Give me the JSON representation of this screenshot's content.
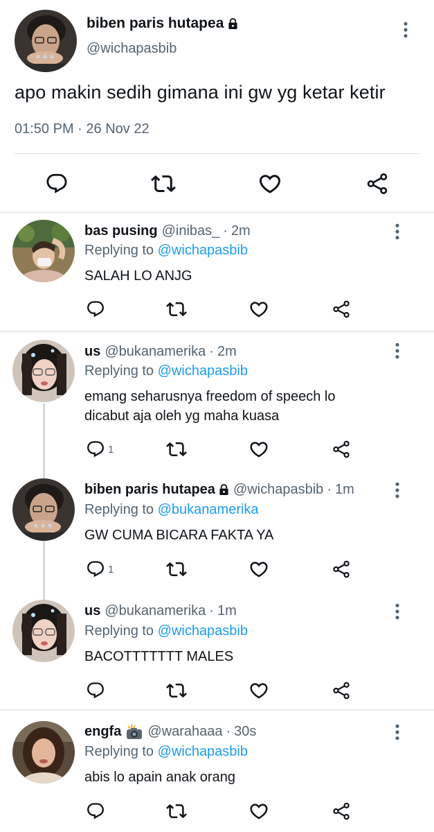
{
  "main_tweet": {
    "name": "biben paris hutapea",
    "handle": "@wichapasbib",
    "text": "apo makin sedih gimana ini gw yg ketar ketir",
    "time": "01:50 PM",
    "dot": "·",
    "date": "26 Nov 22",
    "protected_icon": "lock-icon"
  },
  "replies": [
    {
      "name": "bas pusing",
      "handle": "@inibas_",
      "time": "2m",
      "replying_label": "Replying to",
      "replying_to": "@wichapasbib",
      "text": "SALAH LO ANJG",
      "reply_count": ""
    },
    {
      "name": "us",
      "handle": "@bukanamerika",
      "time": "2m",
      "replying_label": "Replying to",
      "replying_to": "@wichapasbib",
      "text_line1": "emang seharusnya freedom of speech lo",
      "text_line2": "dicabut aja oleh yg maha kuasa",
      "reply_count": "1"
    },
    {
      "name": "biben paris hutapea",
      "handle": "@wichapasbib",
      "time": "1m",
      "replying_label": "Replying to",
      "replying_to": "@bukanamerika",
      "text": "GW CUMA BICARA FAKTA YA",
      "reply_count": "1"
    },
    {
      "name": "us",
      "handle": "@bukanamerika",
      "time": "1m",
      "replying_label": "Replying to",
      "replying_to": "@wichapasbib",
      "text": "BACOTTTTTTT MALES",
      "reply_count": ""
    },
    {
      "name": "engfa",
      "name_emoji": "camera-flash-icon",
      "handle": "@warahaaa",
      "time": "30s",
      "replying_label": "Replying to",
      "replying_to": "@wichapasbib",
      "text": "abis lo apain anak orang",
      "reply_count": ""
    }
  ],
  "separator": "·",
  "colors": {
    "link": "#1d9bf0",
    "muted": "#536471",
    "text": "#0f1419",
    "divider": "#e6e9eb"
  }
}
